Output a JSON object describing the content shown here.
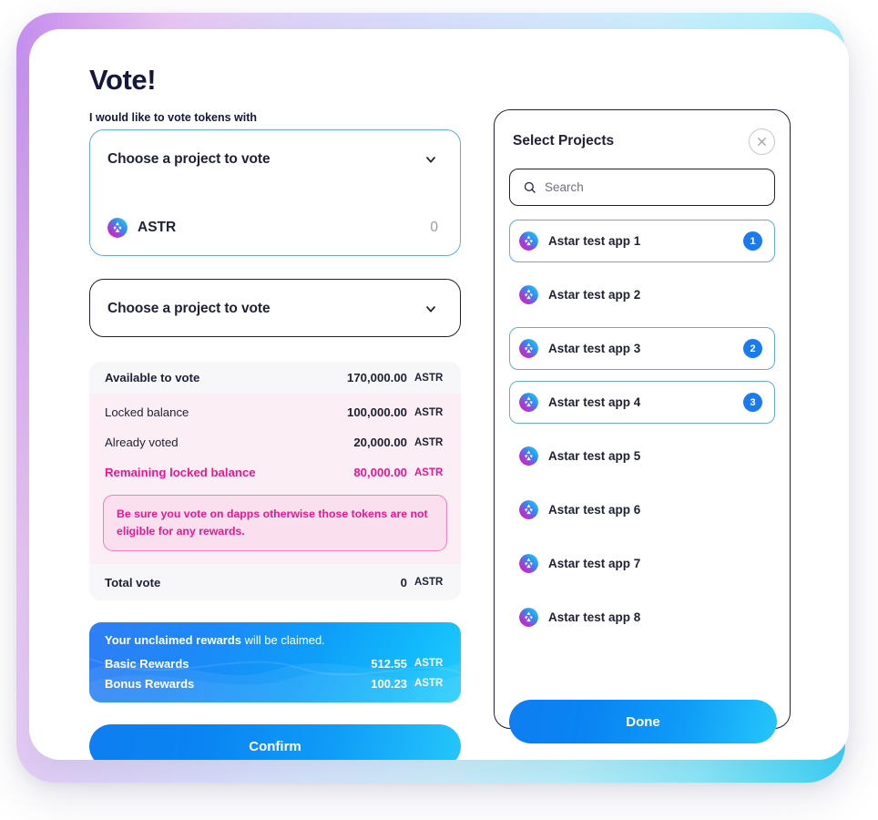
{
  "page": {
    "title": "Vote!",
    "subtitle": "I would like to vote tokens with"
  },
  "colors": {
    "accent_blue": "#1b7bec",
    "accent_magenta": "#ec1690",
    "selected_border": "#63a9e8",
    "panel_border": "#1d2133"
  },
  "selects": [
    {
      "placeholder": "Choose a project to vote",
      "chevron_icon": "chevron-down-icon",
      "token": {
        "icon": "astar-token-icon",
        "symbol": "ASTR",
        "amount": "0"
      }
    },
    {
      "placeholder": "Choose a project to vote",
      "chevron_icon": "chevron-down-icon"
    }
  ],
  "balance": {
    "header": {
      "label": "Available to vote",
      "value": "170,000.00",
      "unit": "ASTR"
    },
    "rows": [
      {
        "label": "Locked balance",
        "value": "100,000.00",
        "unit": "ASTR"
      },
      {
        "label": "Already voted",
        "value": "20,000.00",
        "unit": "ASTR"
      },
      {
        "label": "Remaining locked balance",
        "value": "80,000.00",
        "unit": "ASTR"
      }
    ],
    "warning": "Be sure you vote on dapps otherwise those tokens are not eligible for any rewards.",
    "total": {
      "label": "Total vote",
      "value": "0",
      "unit": "ASTR"
    }
  },
  "rewards": {
    "headline_bold": "Your unclaimed rewards",
    "headline_rest": " will be claimed.",
    "lines": [
      {
        "label": "Basic Rewards",
        "value": "512.55",
        "unit": "ASTR"
      },
      {
        "label": "Bonus Rewards",
        "value": "100.23",
        "unit": "ASTR"
      }
    ]
  },
  "confirm_label": "Confirm",
  "panel": {
    "title": "Select Projects",
    "close_icon": "close-icon",
    "search": {
      "icon": "search-icon",
      "placeholder": "Search",
      "value": ""
    },
    "projects": [
      {
        "icon": "astar-project-icon",
        "name": "Astar test app 1",
        "selected": true,
        "badge": "1"
      },
      {
        "icon": "astar-project-icon",
        "name": "Astar test app 2",
        "selected": false,
        "badge": ""
      },
      {
        "icon": "astar-project-icon",
        "name": "Astar test app 3",
        "selected": true,
        "badge": "2"
      },
      {
        "icon": "astar-project-icon",
        "name": "Astar test app 4",
        "selected": true,
        "badge": "3"
      },
      {
        "icon": "astar-project-icon",
        "name": "Astar test app 5",
        "selected": false,
        "badge": ""
      },
      {
        "icon": "astar-project-icon",
        "name": "Astar test app 6",
        "selected": false,
        "badge": ""
      },
      {
        "icon": "astar-project-icon",
        "name": "Astar test app 7",
        "selected": false,
        "badge": ""
      },
      {
        "icon": "astar-project-icon",
        "name": "Astar test app 8",
        "selected": false,
        "badge": ""
      }
    ],
    "done_label": "Done"
  }
}
